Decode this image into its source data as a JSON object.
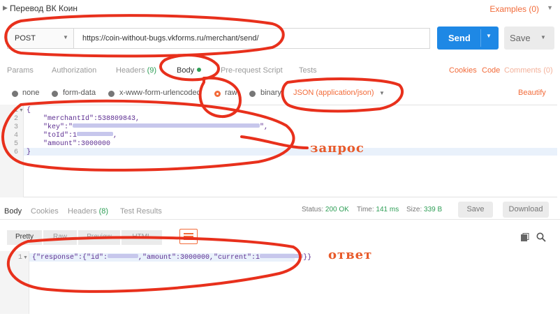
{
  "title": {
    "text": "Перевод ВК Коин",
    "examples": "Examples (0)"
  },
  "request": {
    "method": "POST",
    "url": "https://coin-without-bugs.vkforms.ru/merchant/send/",
    "send_label": "Send",
    "save_label": "Save"
  },
  "request_tabs": {
    "params": "Params",
    "authorization": "Authorization",
    "headers": "Headers",
    "headers_count": "(9)",
    "body": "Body",
    "prerequest": "Pre-request Script",
    "tests": "Tests",
    "cookies": "Cookies",
    "code": "Code",
    "comments": "Comments (0)"
  },
  "body_types": {
    "none": "none",
    "form_data": "form-data",
    "urlencoded": "x-www-form-urlencoded",
    "raw": "raw",
    "binary": "binary",
    "content_type": "JSON (application/json)",
    "beautify": "Beautify"
  },
  "editor": {
    "line_numbers": [
      "1",
      "2",
      "3",
      "4",
      "5",
      "6"
    ],
    "lines": {
      "l1": "{",
      "l2": "    \"merchantId\":538809843,",
      "l3_key": "    \"key\":\"",
      "l3_end": "\",",
      "l4_key": "    \"toId\":1",
      "l4_end": ",",
      "l5": "    \"amount\":3000000",
      "l6": "}"
    }
  },
  "response_tabs": {
    "body": "Body",
    "cookies": "Cookies",
    "headers": "Headers",
    "headers_count": "(8)",
    "test_results": "Test Results"
  },
  "response_meta": {
    "status_label": "Status:",
    "status_value": "200 OK",
    "time_label": "Time:",
    "time_value": "141 ms",
    "size_label": "Size:",
    "size_value": "339 B",
    "save_label": "Save",
    "download_label": "Download"
  },
  "response_view": {
    "pretty": "Pretty",
    "raw": "Raw",
    "preview": "Preview",
    "html": "HTML"
  },
  "response_body": {
    "line_number": "1",
    "part1": "{\"response\":{\"id\":",
    "part2": ",\"amount\":3000000,\"current\":1",
    "part3": "}}"
  },
  "annotations": {
    "request_note": "запрос",
    "response_note": "ответ"
  },
  "colors": {
    "accent": "#f26b3a",
    "send": "#1e88e5",
    "status_ok": "#2e9e56",
    "annotation_ink": "#e8301c"
  }
}
